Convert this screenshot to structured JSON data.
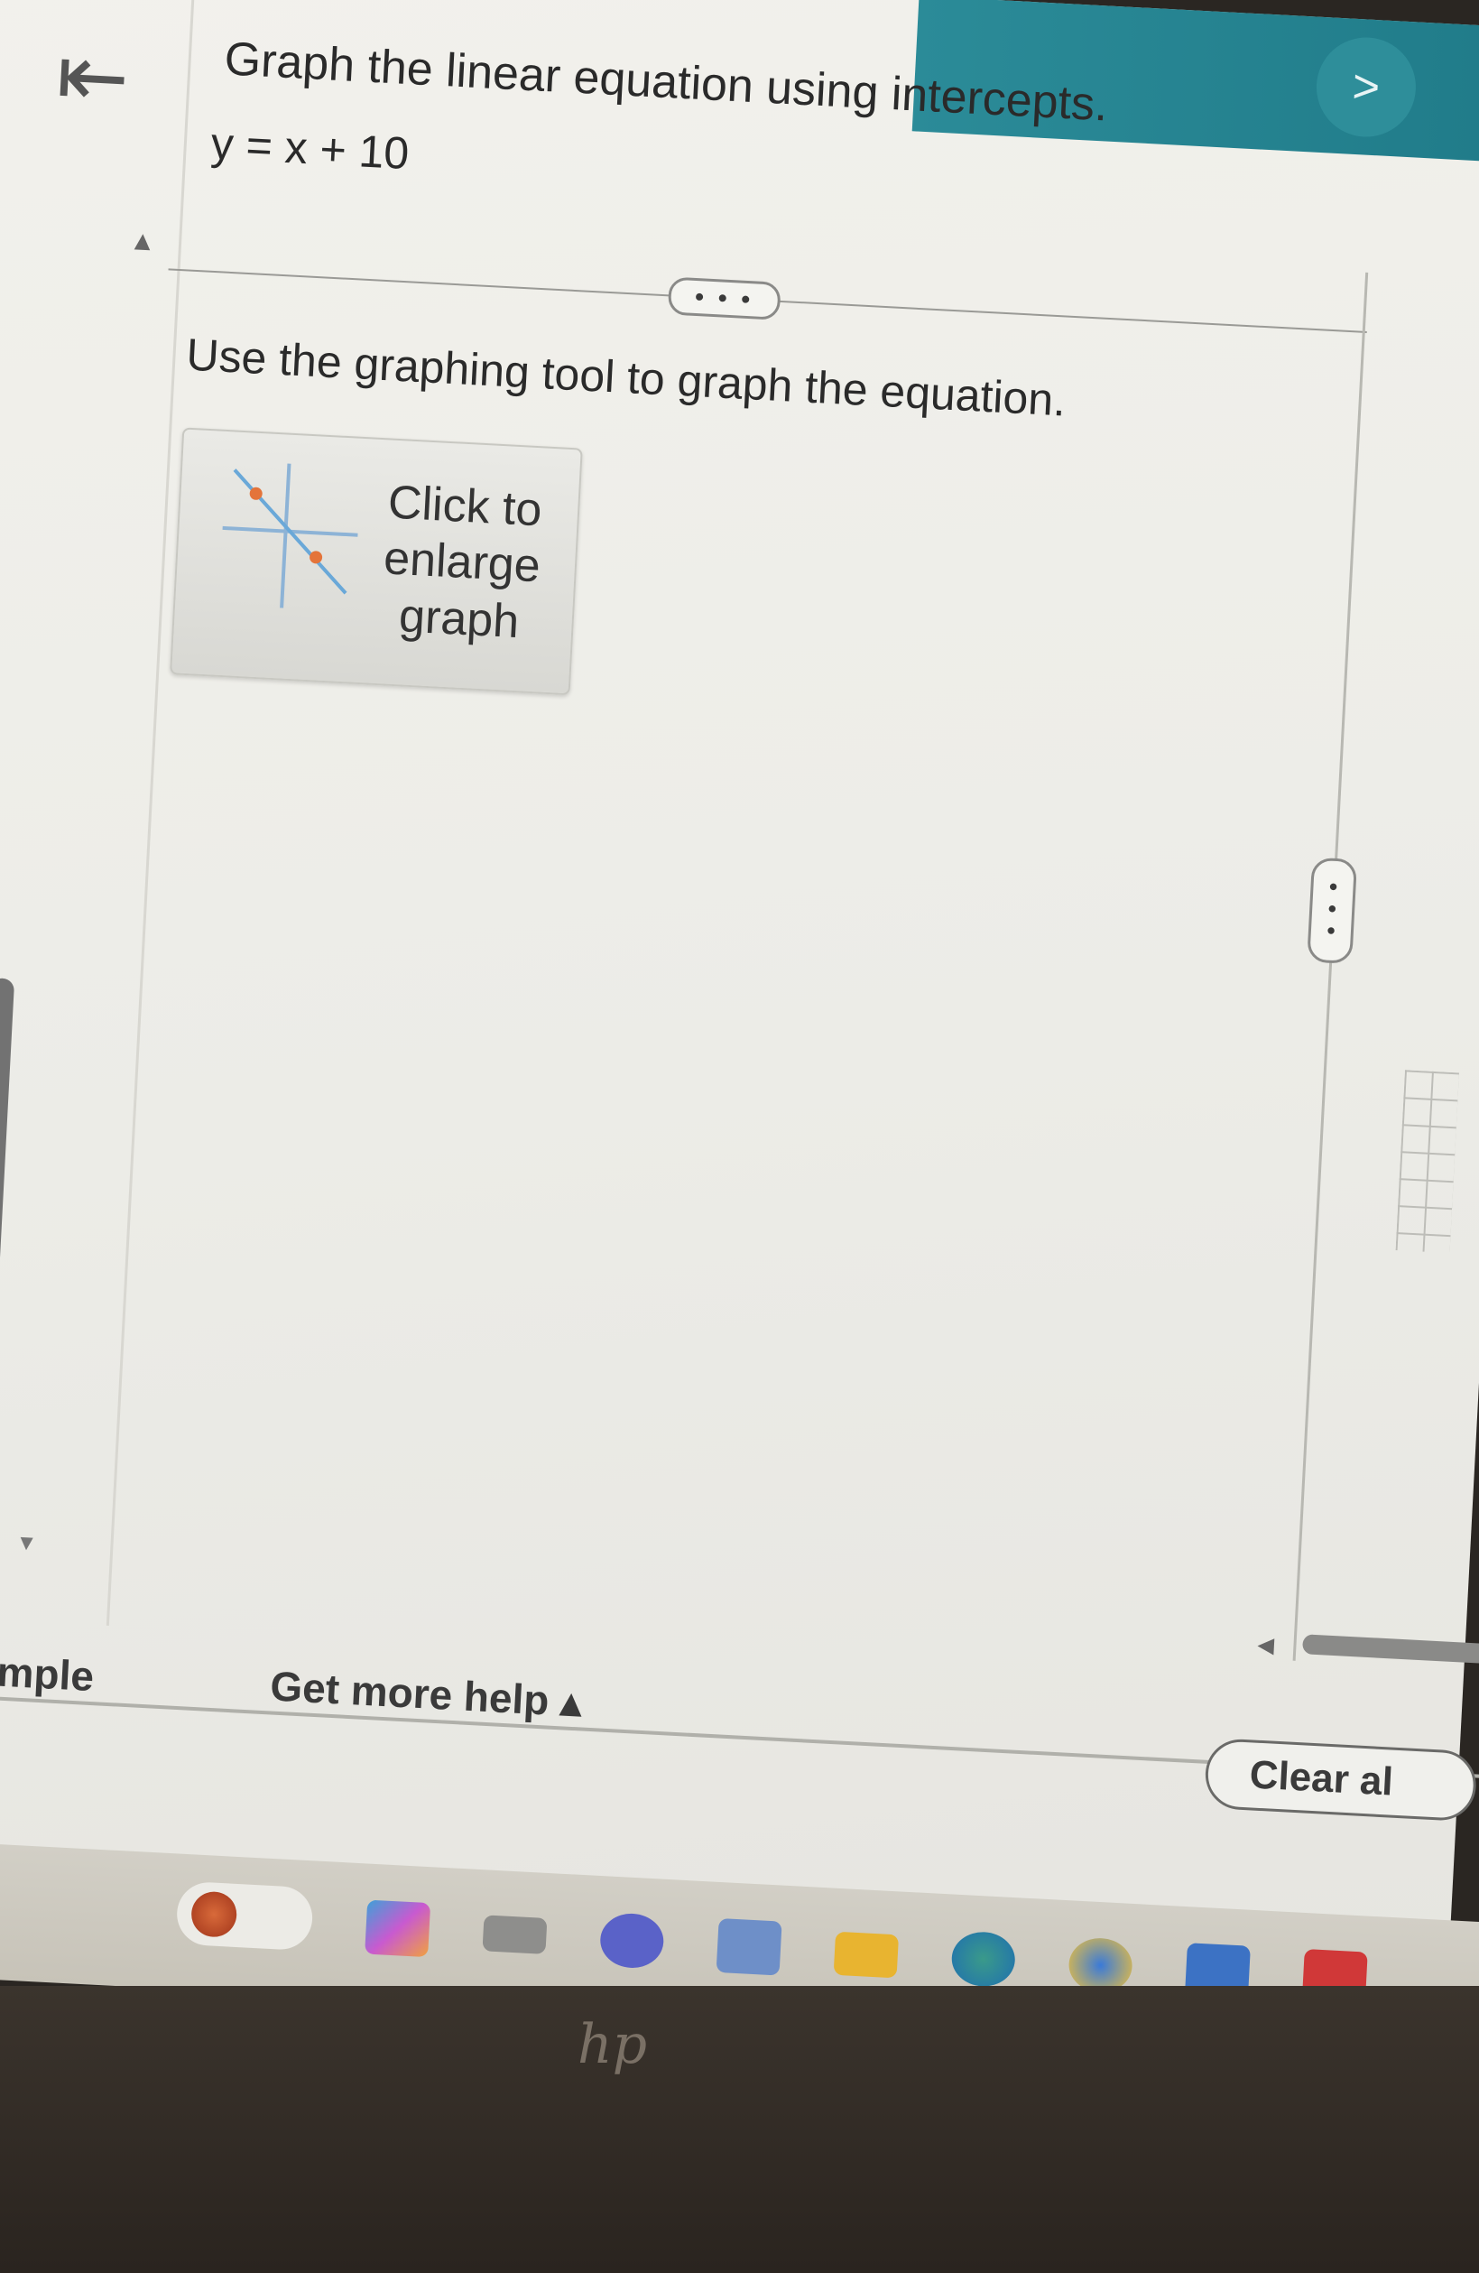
{
  "header": {
    "next_label": ">"
  },
  "question": {
    "back_icon": "first-page-arrow-icon",
    "title": "Graph the linear equation using intercepts.",
    "equation": "y = x + 10",
    "more_label": "• • •",
    "instruction": "Use the graphing tool to graph the equation.",
    "graph_button_label": "Click to enlarge graph"
  },
  "footer": {
    "example_link": "example",
    "help_link": "Get more help ▴",
    "clear_all_label": "Clear al"
  },
  "taskbar": {
    "icons": [
      "search-icon",
      "widgets-icon",
      "file-explorer-icon",
      "teams-icon",
      "store-icon",
      "folder-icon",
      "edge-icon",
      "chrome-icon",
      "app-icon",
      "mail-icon"
    ]
  },
  "device": {
    "logo_text": "hp"
  },
  "colors": {
    "header_teal": "#2b8b98",
    "graph_point_orange": "#e4743a",
    "graph_line_blue": "#6aa8d8"
  }
}
